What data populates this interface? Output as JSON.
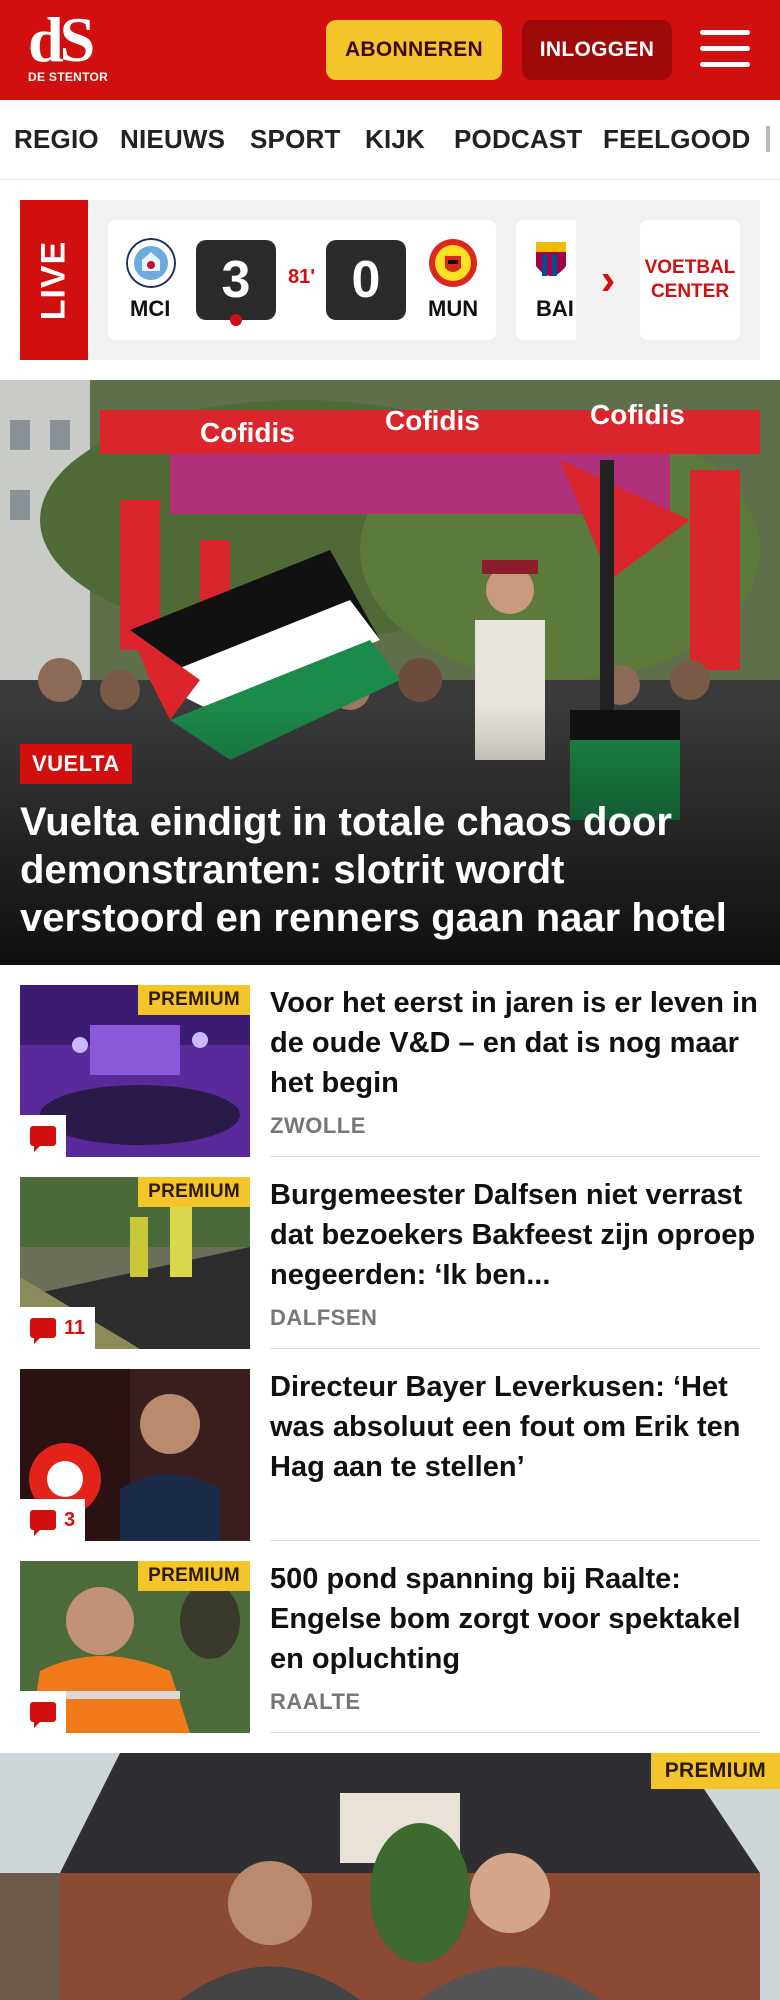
{
  "header": {
    "logo_mark": "dS",
    "logo_sub": "DE STENTOR",
    "subscribe_label": "ABONNEREN",
    "login_label": "INLOGGEN"
  },
  "nav": {
    "items": [
      "REGIO",
      "NIEUWS",
      "SPORT",
      "KIJK",
      "PODCAST",
      "FEELGOOD"
    ]
  },
  "live": {
    "label": "LIVE",
    "match": {
      "home": "MCI",
      "away": "MUN",
      "home_score": "3",
      "away_score": "0",
      "minute": "81'"
    },
    "next_match_home": "BAI",
    "voetbal_center": "VOETBAL CENTER"
  },
  "hero": {
    "tag": "VUELTA",
    "title": "Vuelta eindigt in totale chaos door demonstranten: slotrit wordt verstoord en renners gaan naar hotel",
    "banner_text": "Cofidis"
  },
  "articles": [
    {
      "premium": "PREMIUM",
      "comments": "",
      "title": "Voor het eerst in jaren is er leven in de oude V&D – en dat is nog maar het begin",
      "location": "ZWOLLE"
    },
    {
      "premium": "PREMIUM",
      "comments": "11",
      "title": "Burgemeester Dalfsen niet verrast dat bezoekers Bakfeest zijn oproep negeerden: ‘Ik ben...",
      "location": "DALFSEN"
    },
    {
      "premium": "",
      "comments": "3",
      "title": "Directeur Bayer Leverkusen: ‘Het was absoluut een fout om Erik ten Hag aan te stellen’",
      "location": ""
    },
    {
      "premium": "PREMIUM",
      "comments": "",
      "title": "500 pond spanning bij Raalte: Engelse bom zorgt voor spektakel en opluchting",
      "location": "RAALTE"
    }
  ],
  "feature": {
    "premium": "PREMIUM"
  },
  "colors": {
    "brand_red": "#d20f0f",
    "premium_yellow": "#f4c42b",
    "login_dark_red": "#9e0a0a"
  }
}
